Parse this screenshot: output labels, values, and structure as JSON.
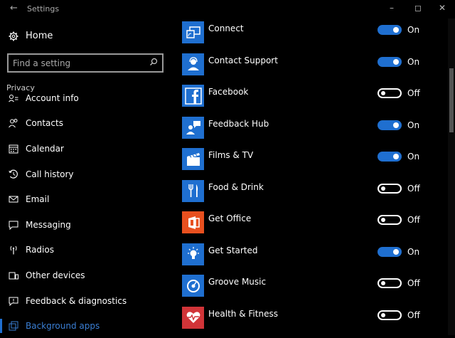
{
  "window": {
    "title": "Settings",
    "back_icon": "back-arrow-icon",
    "controls": [
      "minimize-icon",
      "maximize-icon",
      "close-icon"
    ]
  },
  "sidebar": {
    "home_label": "Home",
    "search_placeholder": "Find a setting",
    "section_label": "Privacy",
    "items": [
      {
        "label": "Account info",
        "icon": "account-info-icon",
        "active": false
      },
      {
        "label": "Contacts",
        "icon": "contacts-icon",
        "active": false
      },
      {
        "label": "Calendar",
        "icon": "calendar-icon",
        "active": false
      },
      {
        "label": "Call history",
        "icon": "call-history-icon",
        "active": false
      },
      {
        "label": "Email",
        "icon": "email-icon",
        "active": false
      },
      {
        "label": "Messaging",
        "icon": "messaging-icon",
        "active": false
      },
      {
        "label": "Radios",
        "icon": "radios-icon",
        "active": false
      },
      {
        "label": "Other devices",
        "icon": "other-devices-icon",
        "active": false
      },
      {
        "label": "Feedback & diagnostics",
        "icon": "feedback-icon",
        "active": false
      },
      {
        "label": "Background apps",
        "icon": "background-apps-icon",
        "active": true
      }
    ]
  },
  "apps": [
    {
      "name": "Connect",
      "state": "On",
      "on": true,
      "icon": "connect-icon",
      "color": "#1f6fd0"
    },
    {
      "name": "Contact Support",
      "state": "On",
      "on": true,
      "icon": "contact-support-icon",
      "color": "#1f6fd0"
    },
    {
      "name": "Facebook",
      "state": "Off",
      "on": false,
      "icon": "facebook-icon",
      "color": "#1f6fd0"
    },
    {
      "name": "Feedback Hub",
      "state": "On",
      "on": true,
      "icon": "feedback-hub-icon",
      "color": "#1f6fd0"
    },
    {
      "name": "Films & TV",
      "state": "On",
      "on": true,
      "icon": "films-tv-icon",
      "color": "#1f6fd0"
    },
    {
      "name": "Food & Drink",
      "state": "Off",
      "on": false,
      "icon": "food-drink-icon",
      "color": "#1f6fd0"
    },
    {
      "name": "Get Office",
      "state": "Off",
      "on": false,
      "icon": "office-icon",
      "color": "#e8501f"
    },
    {
      "name": "Get Started",
      "state": "On",
      "on": true,
      "icon": "get-started-icon",
      "color": "#1f6fd0"
    },
    {
      "name": "Groove Music",
      "state": "Off",
      "on": false,
      "icon": "groove-music-icon",
      "color": "#1f6fd0"
    },
    {
      "name": "Health & Fitness",
      "state": "Off",
      "on": false,
      "icon": "health-fitness-icon",
      "color": "#d13438"
    }
  ],
  "colors": {
    "accent": "#1f6fd0",
    "background": "#000000",
    "active_nav": "#3a7fd5"
  }
}
